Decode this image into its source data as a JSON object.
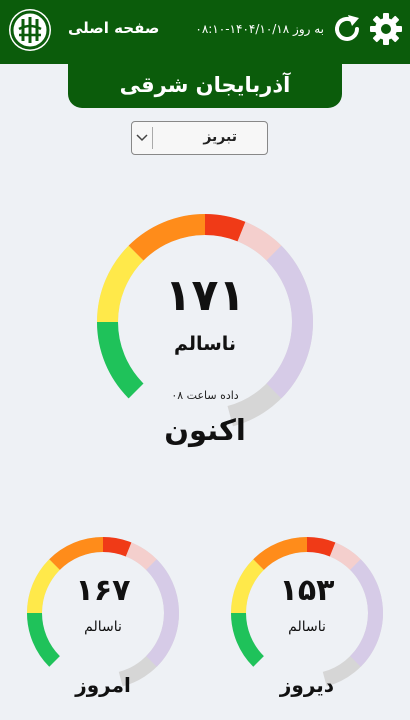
{
  "header": {
    "home_label": "صفحه اصلی",
    "updated_text": "به روز ۱۴۰۴/۱۰/۱۸-۰۸:۱۰"
  },
  "province": {
    "name": "آذربایجان شرقی"
  },
  "city_select": {
    "selected": "تبریز"
  },
  "colors": {
    "brand_green": "#0b5c0b",
    "good": "#1fc25a",
    "moderate": "#ffe94a",
    "sensitive": "#ff8c1a",
    "unhealthy": "#f03a17",
    "very_unhealthy": "#f4cfcd",
    "hazardous": "#d6cbe7",
    "track": "#d6d6d6"
  },
  "gauges": {
    "now": {
      "value": 171,
      "value_text": "۱۷۱",
      "status": "ناسالم",
      "data_hour": "داده ساعت ۰۸",
      "caption": "اکنون"
    },
    "today": {
      "value": 167,
      "value_text": "۱۶۷",
      "status": "ناسالم",
      "caption": "امروز"
    },
    "yesterday": {
      "value": 153,
      "value_text": "۱۵۳",
      "status": "ناسالم",
      "caption": "دیروز"
    }
  }
}
